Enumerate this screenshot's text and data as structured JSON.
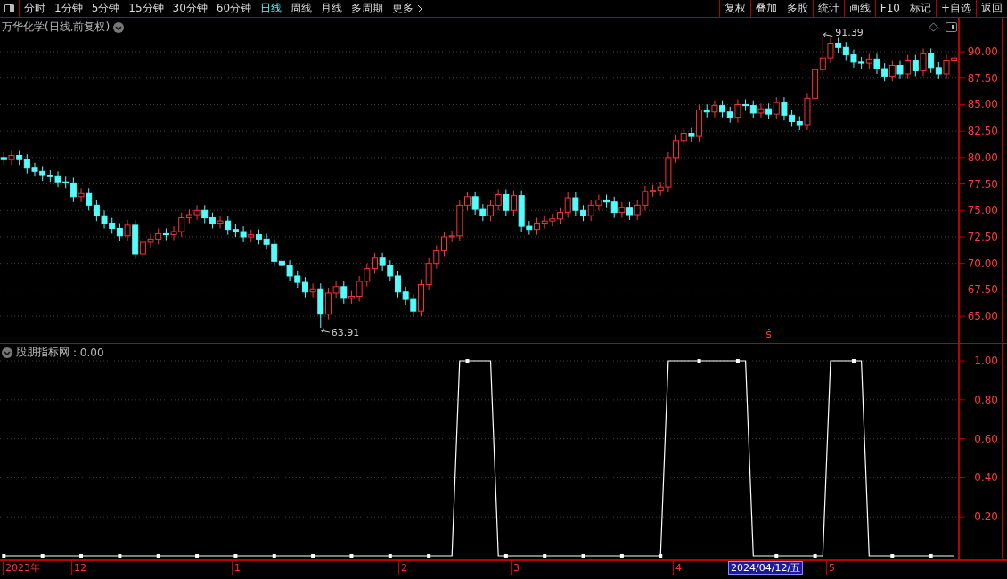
{
  "toolbar": {
    "periods": [
      {
        "label": "分时",
        "selected": false
      },
      {
        "label": "1分钟",
        "selected": false
      },
      {
        "label": "5分钟",
        "selected": false
      },
      {
        "label": "15分钟",
        "selected": false
      },
      {
        "label": "30分钟",
        "selected": false
      },
      {
        "label": "60分钟",
        "selected": false
      },
      {
        "label": "日线",
        "selected": true
      },
      {
        "label": "周线",
        "selected": false
      },
      {
        "label": "月线",
        "selected": false
      },
      {
        "label": "多周期",
        "selected": false
      },
      {
        "label": "更多",
        "selected": false
      }
    ],
    "buttons": [
      "复权",
      "叠加",
      "多股",
      "统计",
      "画线",
      "F10",
      "标记",
      "+自选",
      "返回"
    ]
  },
  "price_panel": {
    "title": "万华化学(日线,前复权)",
    "chart_data": {
      "type": "candlestick",
      "grid": true,
      "ylim": [
        62.4,
        93.2
      ],
      "yticks": [
        {
          "value": 90,
          "label": "90.00"
        },
        {
          "value": 87.5,
          "label": "87.50"
        },
        {
          "value": 85,
          "label": "85.00"
        },
        {
          "value": 82.5,
          "label": "82.50"
        },
        {
          "value": 80,
          "label": "80.00"
        },
        {
          "value": 77.5,
          "label": "77.50"
        },
        {
          "value": 75,
          "label": "75.00"
        },
        {
          "value": 72.5,
          "label": "72.50"
        },
        {
          "value": 70,
          "label": "70.00"
        },
        {
          "value": 67.5,
          "label": "67.50"
        },
        {
          "value": 65,
          "label": "65.00"
        }
      ],
      "categories": [
        null,
        null,
        null,
        null,
        null,
        null,
        null,
        null,
        null,
        null,
        null,
        null,
        null,
        null,
        null,
        null,
        null,
        null,
        null,
        null,
        null,
        null,
        null,
        null,
        null,
        null,
        null,
        null,
        null,
        null,
        null,
        null,
        null,
        null,
        null,
        null,
        null,
        null,
        null,
        null,
        null,
        null,
        null,
        null,
        null,
        null,
        null,
        null,
        null,
        null,
        null,
        null,
        null,
        null,
        null,
        null,
        null,
        null,
        null,
        null,
        null,
        null,
        null,
        null,
        null,
        null,
        null,
        null,
        null,
        null,
        null,
        null,
        null,
        null,
        null,
        null,
        null,
        null,
        null,
        null,
        null,
        null,
        null,
        null,
        null,
        null,
        null,
        null,
        null,
        null,
        null,
        null,
        null,
        null,
        null,
        null,
        null,
        null,
        null,
        null,
        null,
        null,
        null,
        null,
        null,
        null,
        null,
        null,
        null,
        null,
        null,
        null,
        null,
        null,
        null,
        null,
        null,
        null,
        null,
        null,
        null,
        null,
        null,
        null
      ],
      "ohlc": [
        [
          80.0,
          80.5,
          79.3,
          79.8
        ],
        [
          79.8,
          80.7,
          79.3,
          80.2
        ],
        [
          80.2,
          80.7,
          79.3,
          79.8
        ],
        [
          79.8,
          80.3,
          78.5,
          79.0
        ],
        [
          79.0,
          79.5,
          78.2,
          78.7
        ],
        [
          78.7,
          79.2,
          77.8,
          78.3
        ],
        [
          78.3,
          78.8,
          77.7,
          78.2
        ],
        [
          78.2,
          78.7,
          77.2,
          77.7
        ],
        [
          77.7,
          78.2,
          77.1,
          77.6
        ],
        [
          77.6,
          78.1,
          75.8,
          76.3
        ],
        [
          76.3,
          77.1,
          75.8,
          76.6
        ],
        [
          76.6,
          77.1,
          75.0,
          75.5
        ],
        [
          75.5,
          76.0,
          74.0,
          74.5
        ],
        [
          74.5,
          75.0,
          73.3,
          73.8
        ],
        [
          73.8,
          74.3,
          72.8,
          73.3
        ],
        [
          73.3,
          73.8,
          72.1,
          72.6
        ],
        [
          72.6,
          74.1,
          72.1,
          73.6
        ],
        [
          73.6,
          74.1,
          70.4,
          70.9
        ],
        [
          70.9,
          72.5,
          70.4,
          72.0
        ],
        [
          72.0,
          72.8,
          71.5,
          72.3
        ],
        [
          72.3,
          73.3,
          71.8,
          72.8
        ],
        [
          72.8,
          73.3,
          72.2,
          72.7
        ],
        [
          72.7,
          73.5,
          72.2,
          73.0
        ],
        [
          73.0,
          74.8,
          72.5,
          74.3
        ],
        [
          74.3,
          75.1,
          73.8,
          74.6
        ],
        [
          74.6,
          75.5,
          74.1,
          75.0
        ],
        [
          75.0,
          75.5,
          73.8,
          74.3
        ],
        [
          74.3,
          74.8,
          73.3,
          73.8
        ],
        [
          73.8,
          74.5,
          73.3,
          74.0
        ],
        [
          74.0,
          74.5,
          72.7,
          73.2
        ],
        [
          73.2,
          73.7,
          72.5,
          73.0
        ],
        [
          73.0,
          73.5,
          72.0,
          72.5
        ],
        [
          72.5,
          73.2,
          72.0,
          72.7
        ],
        [
          72.7,
          73.2,
          71.8,
          72.3
        ],
        [
          72.3,
          72.8,
          71.3,
          71.8
        ],
        [
          71.8,
          72.3,
          69.7,
          70.2
        ],
        [
          70.2,
          70.7,
          69.3,
          69.8
        ],
        [
          69.8,
          70.3,
          68.3,
          68.8
        ],
        [
          68.8,
          69.3,
          67.7,
          68.2
        ],
        [
          68.2,
          68.7,
          66.8,
          67.3
        ],
        [
          67.3,
          68.1,
          66.8,
          67.6
        ],
        [
          67.6,
          68.1,
          63.91,
          65.2
        ],
        [
          65.2,
          67.7,
          64.7,
          67.2
        ],
        [
          67.2,
          68.3,
          66.7,
          67.8
        ],
        [
          67.8,
          68.3,
          66.2,
          66.7
        ],
        [
          66.7,
          67.4,
          66.2,
          66.9
        ],
        [
          66.9,
          68.8,
          66.4,
          68.3
        ],
        [
          68.3,
          70.0,
          67.8,
          69.5
        ],
        [
          69.5,
          71.0,
          69.0,
          70.5
        ],
        [
          70.5,
          71.0,
          69.3,
          69.8
        ],
        [
          69.8,
          70.3,
          68.3,
          68.8
        ],
        [
          68.8,
          69.3,
          66.8,
          67.3
        ],
        [
          67.3,
          67.8,
          66.1,
          66.6
        ],
        [
          66.6,
          67.1,
          65.0,
          65.5
        ],
        [
          65.5,
          68.5,
          65.0,
          68.0
        ],
        [
          68.0,
          70.5,
          67.5,
          70.0
        ],
        [
          70.0,
          71.7,
          69.5,
          71.2
        ],
        [
          71.2,
          73.0,
          70.7,
          72.5
        ],
        [
          72.5,
          73.1,
          72.0,
          72.6
        ],
        [
          72.6,
          76.0,
          72.1,
          75.5
        ],
        [
          75.5,
          76.8,
          75.0,
          76.3
        ],
        [
          76.3,
          76.8,
          74.6,
          75.1
        ],
        [
          75.1,
          75.6,
          74.0,
          74.5
        ],
        [
          74.5,
          76.0,
          74.0,
          75.5
        ],
        [
          75.5,
          77.0,
          75.0,
          76.5
        ],
        [
          76.5,
          77.0,
          74.5,
          75.0
        ],
        [
          75.0,
          76.9,
          74.5,
          76.4
        ],
        [
          76.4,
          76.9,
          73.0,
          73.5
        ],
        [
          73.5,
          74.0,
          72.7,
          73.2
        ],
        [
          73.2,
          74.3,
          72.7,
          73.8
        ],
        [
          73.8,
          74.5,
          73.3,
          74.0
        ],
        [
          74.0,
          74.7,
          73.5,
          74.2
        ],
        [
          74.2,
          75.3,
          73.7,
          74.8
        ],
        [
          74.8,
          76.7,
          74.3,
          76.2
        ],
        [
          76.2,
          76.7,
          74.5,
          75.0
        ],
        [
          75.0,
          75.5,
          74.0,
          74.5
        ],
        [
          74.5,
          76.0,
          74.0,
          75.5
        ],
        [
          75.5,
          76.5,
          75.0,
          76.0
        ],
        [
          76.0,
          76.5,
          75.3,
          75.8
        ],
        [
          75.8,
          76.3,
          74.3,
          74.8
        ],
        [
          74.8,
          75.8,
          74.3,
          75.3
        ],
        [
          75.3,
          75.8,
          74.1,
          74.6
        ],
        [
          74.6,
          76.0,
          74.1,
          75.5
        ],
        [
          75.5,
          77.3,
          75.0,
          76.8
        ],
        [
          76.8,
          77.4,
          76.3,
          76.9
        ],
        [
          76.9,
          77.7,
          76.4,
          77.2
        ],
        [
          77.2,
          80.5,
          76.7,
          80.0
        ],
        [
          80.0,
          82.1,
          79.5,
          81.6
        ],
        [
          81.6,
          82.8,
          81.1,
          82.3
        ],
        [
          82.3,
          82.8,
          81.5,
          82.0
        ],
        [
          82.0,
          85.0,
          81.5,
          84.5
        ],
        [
          84.5,
          85.0,
          83.8,
          84.3
        ],
        [
          84.3,
          85.4,
          83.8,
          84.9
        ],
        [
          84.9,
          85.4,
          83.8,
          84.3
        ],
        [
          84.3,
          84.8,
          83.3,
          83.8
        ],
        [
          83.8,
          85.5,
          83.3,
          85.0
        ],
        [
          85.0,
          85.5,
          84.4,
          84.9
        ],
        [
          84.9,
          85.4,
          83.7,
          84.2
        ],
        [
          84.2,
          85.1,
          83.7,
          84.6
        ],
        [
          84.6,
          85.1,
          83.6,
          84.1
        ],
        [
          84.1,
          85.7,
          83.6,
          85.2
        ],
        [
          85.2,
          85.7,
          83.5,
          84.0
        ],
        [
          84.0,
          84.5,
          82.9,
          83.4
        ],
        [
          83.4,
          83.9,
          82.6,
          83.1
        ],
        [
          83.1,
          86.1,
          82.6,
          85.6
        ],
        [
          85.6,
          88.8,
          85.1,
          88.3
        ],
        [
          88.3,
          91.39,
          87.8,
          89.4
        ],
        [
          89.4,
          91.3,
          88.9,
          90.8
        ],
        [
          90.8,
          91.3,
          89.9,
          90.4
        ],
        [
          90.4,
          90.9,
          89.2,
          89.7
        ],
        [
          89.7,
          90.2,
          88.5,
          89.0
        ],
        [
          89.0,
          89.5,
          88.4,
          88.9
        ],
        [
          88.9,
          89.8,
          88.4,
          89.3
        ],
        [
          89.3,
          89.8,
          87.9,
          88.4
        ],
        [
          88.4,
          88.9,
          87.2,
          87.7
        ],
        [
          87.7,
          89.2,
          87.2,
          88.7
        ],
        [
          88.7,
          89.2,
          87.4,
          87.9
        ],
        [
          87.9,
          89.7,
          87.4,
          89.2
        ],
        [
          89.2,
          89.7,
          87.7,
          88.2
        ],
        [
          88.2,
          90.3,
          87.7,
          89.8
        ],
        [
          89.8,
          90.3,
          88.0,
          88.5
        ],
        [
          88.5,
          89.0,
          87.4,
          87.9
        ],
        [
          87.9,
          89.7,
          87.4,
          89.2
        ],
        [
          89.2,
          89.9,
          88.7,
          89.4
        ]
      ],
      "annotations": [
        "63.91",
        "91.39",
        "ŝ"
      ]
    }
  },
  "indicator_panel": {
    "reading": ": 0.00",
    "chart_data": {
      "type": "line",
      "grid": true,
      "ylim": [
        -0.023,
        1.087
      ],
      "yticks": [
        {
          "value": 1,
          "label": "1.00"
        },
        {
          "value": 0.8,
          "label": "0.80"
        },
        {
          "value": 0.6,
          "label": "0.60"
        },
        {
          "value": 0.4,
          "label": "0.40"
        },
        {
          "value": 0.2,
          "label": "0.20"
        }
      ],
      "categories": [
        null,
        null,
        null,
        null,
        null,
        null,
        null,
        null,
        null,
        null,
        null,
        null,
        null,
        null,
        null,
        null,
        null,
        null,
        null,
        null,
        null,
        null,
        null,
        null,
        null,
        null,
        null,
        null,
        null,
        null,
        null,
        null,
        null,
        null,
        null,
        null,
        null,
        null,
        null,
        null,
        null,
        null,
        null,
        null,
        null,
        null,
        null,
        null,
        null,
        null,
        null,
        null,
        null,
        null,
        null,
        null,
        null,
        null,
        null,
        null,
        null,
        null,
        null,
        null,
        null,
        null,
        null,
        null,
        null,
        null,
        null,
        null,
        null,
        null,
        null,
        null,
        null,
        null,
        null,
        null,
        null,
        null,
        null,
        null,
        null,
        null,
        null,
        null,
        null,
        null,
        null,
        null,
        null,
        null,
        null,
        null,
        null,
        null,
        null,
        null,
        null,
        null,
        null,
        null,
        null,
        null,
        null,
        null,
        null,
        null,
        null,
        null,
        null,
        null,
        null,
        null,
        null,
        null,
        null,
        null,
        null,
        null,
        null,
        null
      ],
      "series": [
        {
          "name": "股朋指标网",
          "color": "#ffffff",
          "values": [
            0,
            0,
            0,
            0,
            0,
            0,
            0,
            0,
            0,
            0,
            0,
            0,
            0,
            0,
            0,
            0,
            0,
            0,
            0,
            0,
            0,
            0,
            0,
            0,
            0,
            0,
            0,
            0,
            0,
            0,
            0,
            0,
            0,
            0,
            0,
            0,
            0,
            0,
            0,
            0,
            0,
            0,
            0,
            0,
            0,
            0,
            0,
            0,
            0,
            0,
            0,
            0,
            0,
            0,
            0,
            0,
            0,
            0,
            0,
            1,
            1,
            1,
            1,
            1,
            0,
            0,
            0,
            0,
            0,
            0,
            0,
            0,
            0,
            0,
            0,
            0,
            0,
            0,
            0,
            0,
            0,
            0,
            0,
            0,
            0,
            0,
            1,
            1,
            1,
            1,
            1,
            1,
            1,
            1,
            1,
            1,
            1,
            0,
            0,
            0,
            0,
            0,
            0,
            0,
            0,
            0,
            0,
            1,
            1,
            1,
            1,
            1,
            0,
            0,
            0,
            0,
            0,
            0,
            0,
            0,
            0,
            0,
            0,
            0
          ]
        }
      ]
    }
  },
  "date_axis": [
    "2023年",
    "12",
    "1",
    "2",
    "3",
    "4",
    "5"
  ],
  "cursor_date": "2024/04/12/五"
}
